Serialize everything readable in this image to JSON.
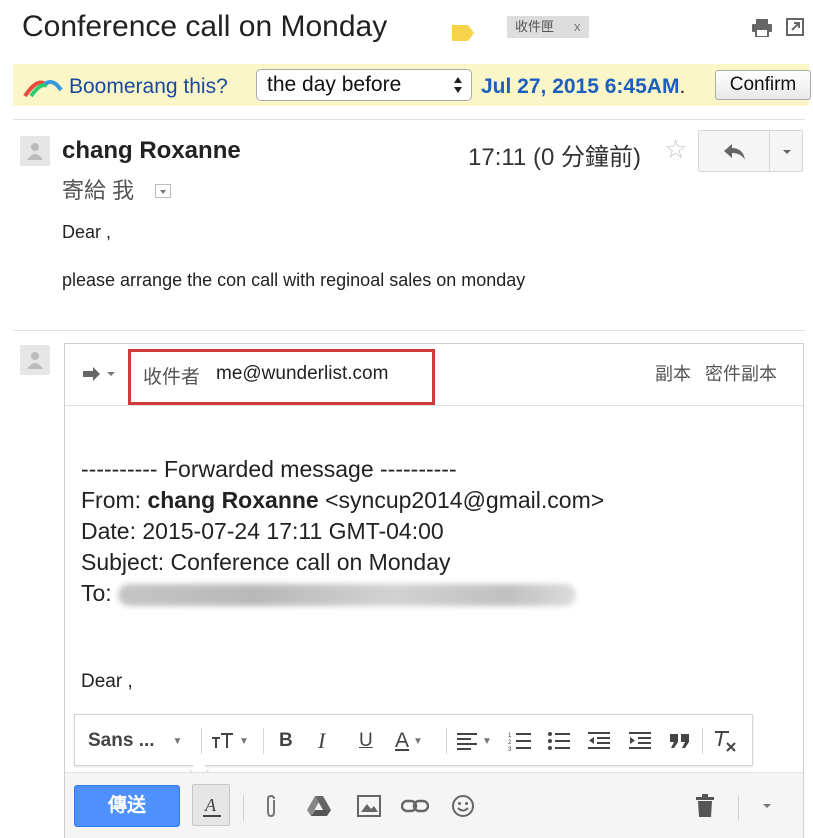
{
  "subject": "Conference call on Monday",
  "label_chip": {
    "text": "收件匣",
    "remove": "x"
  },
  "icons": [
    "label-icon",
    "print-icon",
    "new-window-icon",
    "boomerang-logo-icon",
    "select-arrows-icon",
    "person-icon",
    "star-icon",
    "reply-icon",
    "chevron-down-icon",
    "forward-arrow-icon",
    "font-size-icon",
    "bold-icon",
    "italic-icon",
    "underline-icon",
    "text-color-icon",
    "align-icon",
    "numbered-list-icon",
    "bulleted-list-icon",
    "indent-less-icon",
    "indent-more-icon",
    "quote-icon",
    "remove-formatting-icon",
    "formatting-toggle-icon",
    "attach-icon",
    "drive-icon",
    "photo-icon",
    "link-icon",
    "emoji-icon",
    "trash-icon"
  ],
  "colors": {
    "boomerang_bg": "#fbf6c7",
    "link_blue": "#1a4aa0",
    "date_blue": "#1d5fbf",
    "send_blue": "#4d90fe",
    "highlight_red": "#d23b3b"
  },
  "boomerang": {
    "prompt": "Boomerang this?",
    "select_value": "the day before",
    "date": "Jul 27, 2015 6:45AM",
    "dot": ".",
    "confirm": "Confirm"
  },
  "message": {
    "sender": "chang Roxanne",
    "to_line": "寄給 我",
    "time": "17:11 (0 分鐘前)",
    "star": "☆",
    "body": [
      "Dear ,",
      "please arrange the con call with reginoal sales on monday"
    ]
  },
  "compose": {
    "to_label": "收件者",
    "to_value": "me@wunderlist.com",
    "cc": "副本",
    "bcc": "密件副本",
    "forwarded": {
      "header": "---------- Forwarded message ----------",
      "from_label": "From:",
      "from_name": "chang Roxanne",
      "from_email": "<syncup2014@gmail.com>",
      "date_line": "Date: 2015-07-24 17:11 GMT-04:00",
      "subject_line": "Subject: Conference call on Monday",
      "to_label": "To:"
    },
    "dear": "Dear ,",
    "toolbar": {
      "font": "Sans ...",
      "bold": "B",
      "italic": "I",
      "underline": "U",
      "text_color": "A"
    },
    "send": "傳送"
  }
}
